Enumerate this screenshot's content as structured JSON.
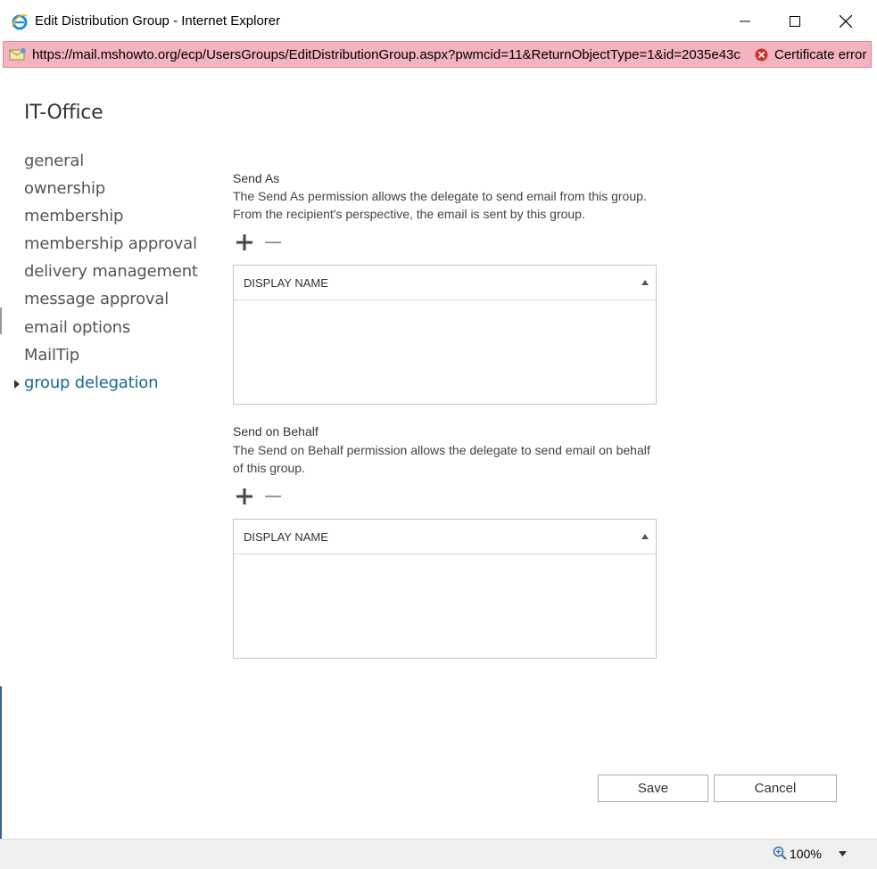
{
  "window": {
    "title": "Edit Distribution Group - Internet Explorer"
  },
  "address": {
    "url": "https://mail.mshowto.org/ecp/UsersGroups/EditDistributionGroup.aspx?pwmcid=11&ReturnObjectType=1&id=2035e43c",
    "cert_error": "Certificate error"
  },
  "group": {
    "name": "IT-Office"
  },
  "nav": {
    "items": [
      {
        "label": "general"
      },
      {
        "label": "ownership"
      },
      {
        "label": "membership"
      },
      {
        "label": "membership approval"
      },
      {
        "label": "delivery management"
      },
      {
        "label": "message approval"
      },
      {
        "label": "email options"
      },
      {
        "label": "MailTip"
      },
      {
        "label": "group delegation"
      }
    ],
    "active": "group delegation"
  },
  "send_as": {
    "label": "Send As",
    "description": "The Send As permission allows the delegate to send email from this group. From the recipient's perspective, the email is sent by this group.",
    "column_header": "DISPLAY NAME"
  },
  "send_on_behalf": {
    "label": "Send on Behalf",
    "description": "The Send on Behalf permission allows the delegate to send email on behalf of this group.",
    "column_header": "DISPLAY NAME"
  },
  "buttons": {
    "save": "Save",
    "cancel": "Cancel"
  },
  "status": {
    "zoom": "100%"
  },
  "colors": {
    "accent": "#1a6796",
    "address_error_bg": "#f3b3bf"
  },
  "icons": {
    "browser": "ie-icon",
    "add": "plus-icon",
    "remove": "minus-icon",
    "sort": "sort-ascending-icon",
    "certificate": "error-icon",
    "zoom": "magnifier-icon"
  }
}
